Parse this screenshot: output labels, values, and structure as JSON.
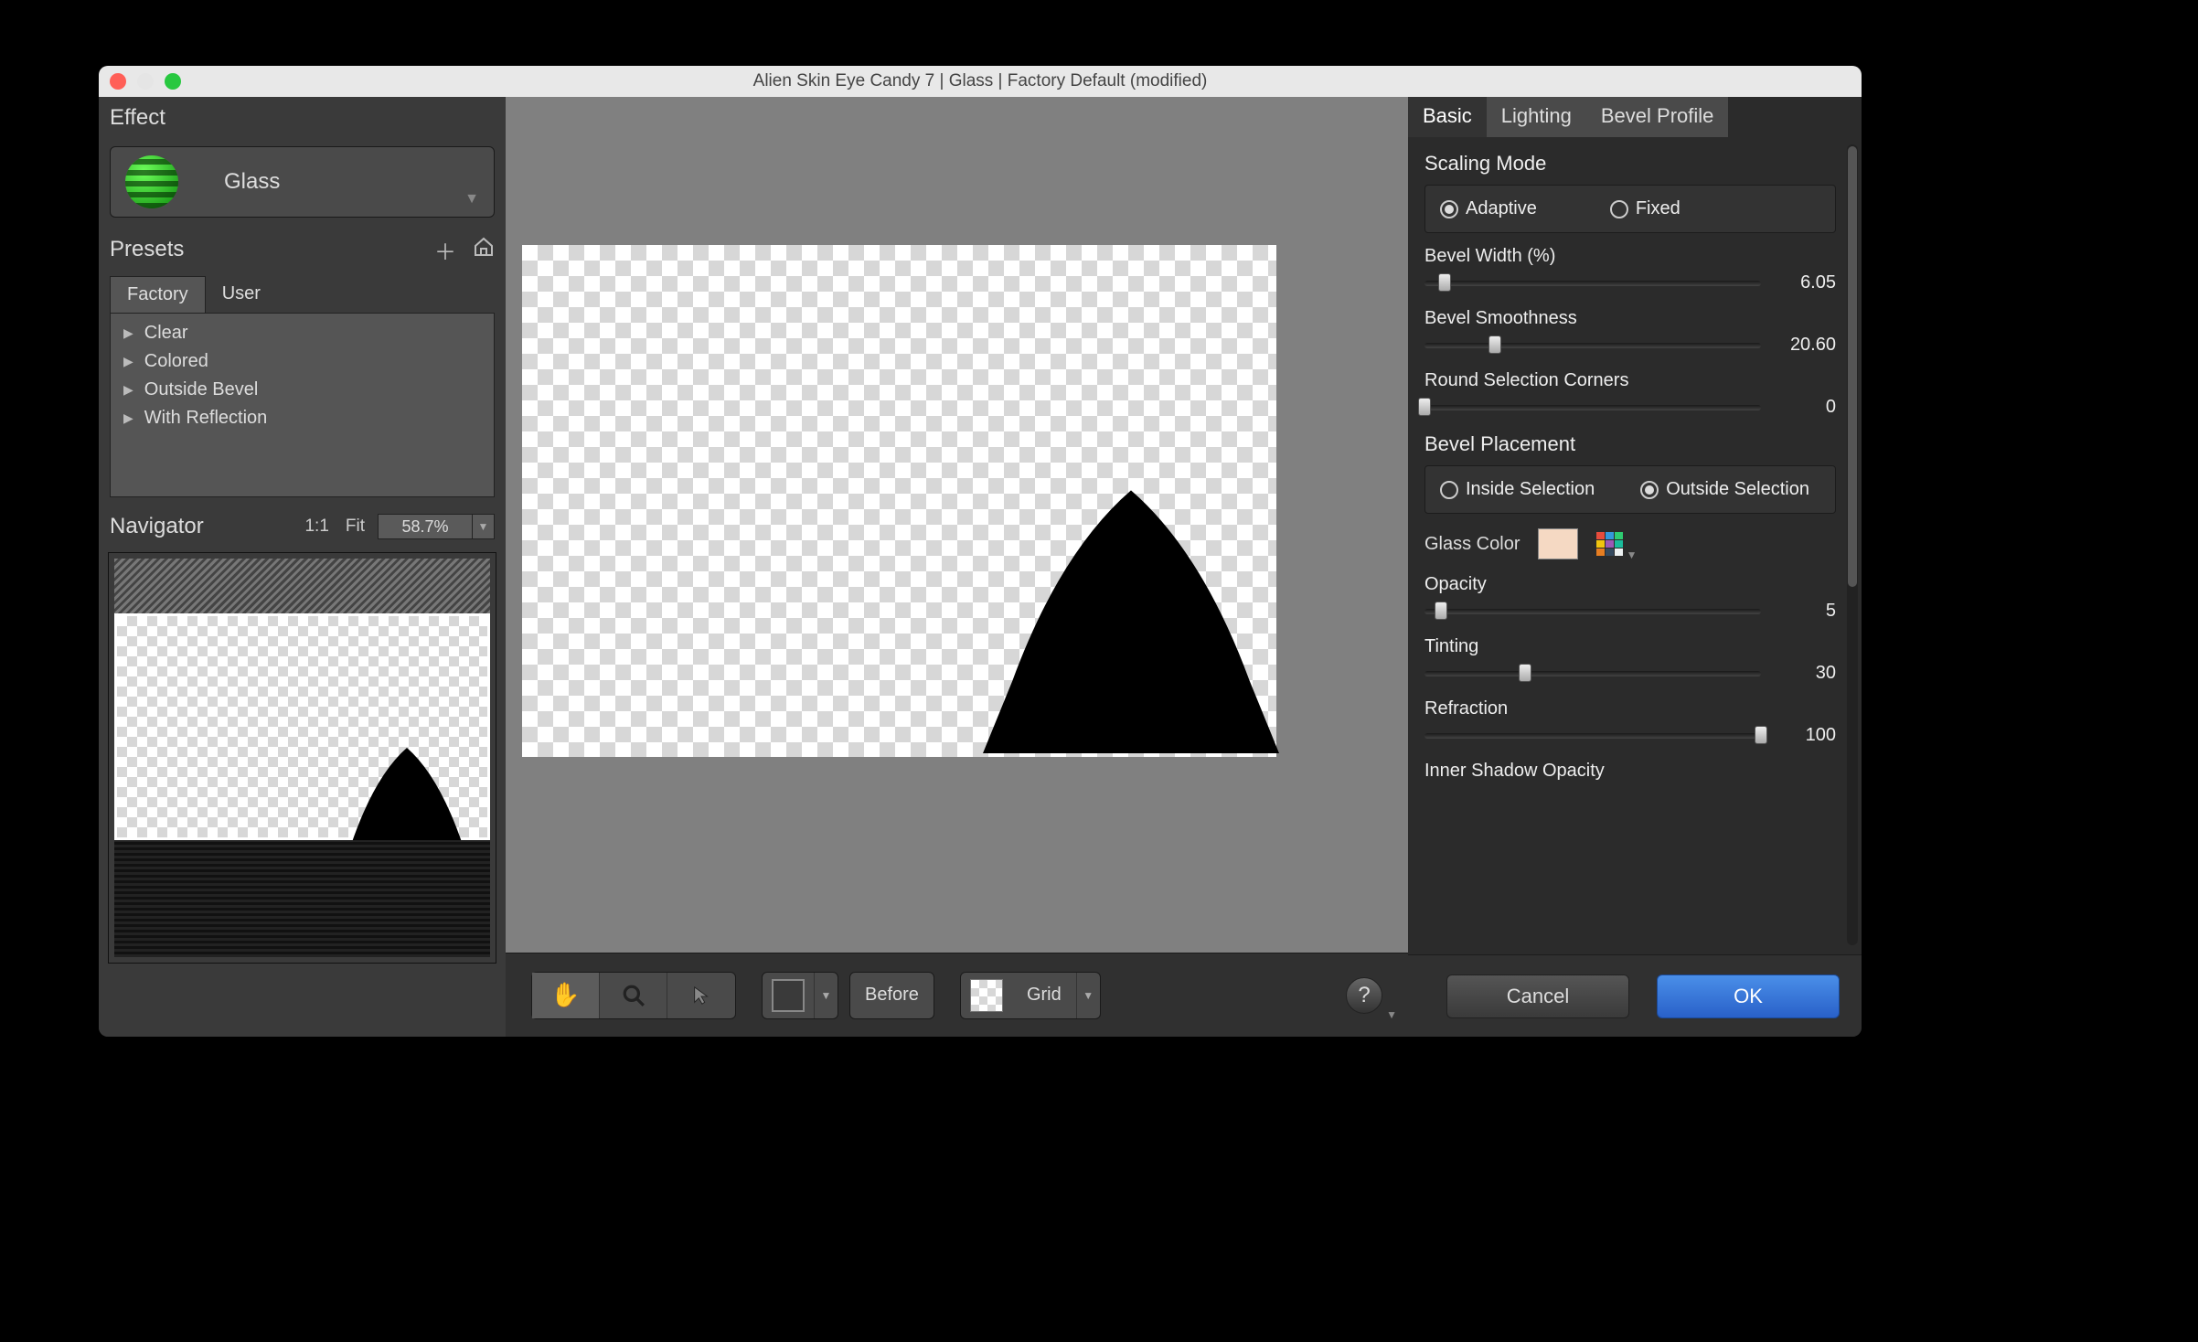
{
  "window": {
    "title": "Alien Skin Eye Candy 7 | Glass | Factory Default (modified)"
  },
  "traffic": {
    "close": "#ff5f57",
    "min": "#e5e5e5",
    "max": "#28c840"
  },
  "effect": {
    "header": "Effect",
    "name": "Glass"
  },
  "presets": {
    "header": "Presets",
    "tabs": [
      "Factory",
      "User"
    ],
    "active_tab": 0,
    "items": [
      "Clear",
      "Colored",
      "Outside Bevel",
      "With Reflection"
    ]
  },
  "navigator": {
    "header": "Navigator",
    "one_to_one": "1:1",
    "fit": "Fit",
    "zoom": "58.7%"
  },
  "toolbar": {
    "before": "Before",
    "bg": "Grid"
  },
  "tabs": [
    "Basic",
    "Lighting",
    "Bevel Profile"
  ],
  "active_panel_tab": 0,
  "panel": {
    "scaling": {
      "title": "Scaling Mode",
      "options": [
        "Adaptive",
        "Fixed"
      ],
      "selected": 0
    },
    "bevel_width": {
      "label": "Bevel Width (%)",
      "value": "6.05",
      "pct": 6
    },
    "bevel_smoothness": {
      "label": "Bevel Smoothness",
      "value": "20.60",
      "pct": 21
    },
    "round_corners": {
      "label": "Round Selection Corners",
      "value": "0",
      "pct": 0
    },
    "bevel_placement": {
      "title": "Bevel Placement",
      "options": [
        "Inside Selection",
        "Outside Selection"
      ],
      "selected": 1
    },
    "glass_color": {
      "label": "Glass Color",
      "swatch": "#f5d9c3"
    },
    "opacity": {
      "label": "Opacity",
      "value": "5",
      "pct": 5
    },
    "tinting": {
      "label": "Tinting",
      "value": "30",
      "pct": 30
    },
    "refraction": {
      "label": "Refraction",
      "value": "100",
      "pct": 100
    },
    "inner_shadow": {
      "label": "Inner Shadow Opacity"
    }
  },
  "buttons": {
    "cancel": "Cancel",
    "ok": "OK"
  }
}
